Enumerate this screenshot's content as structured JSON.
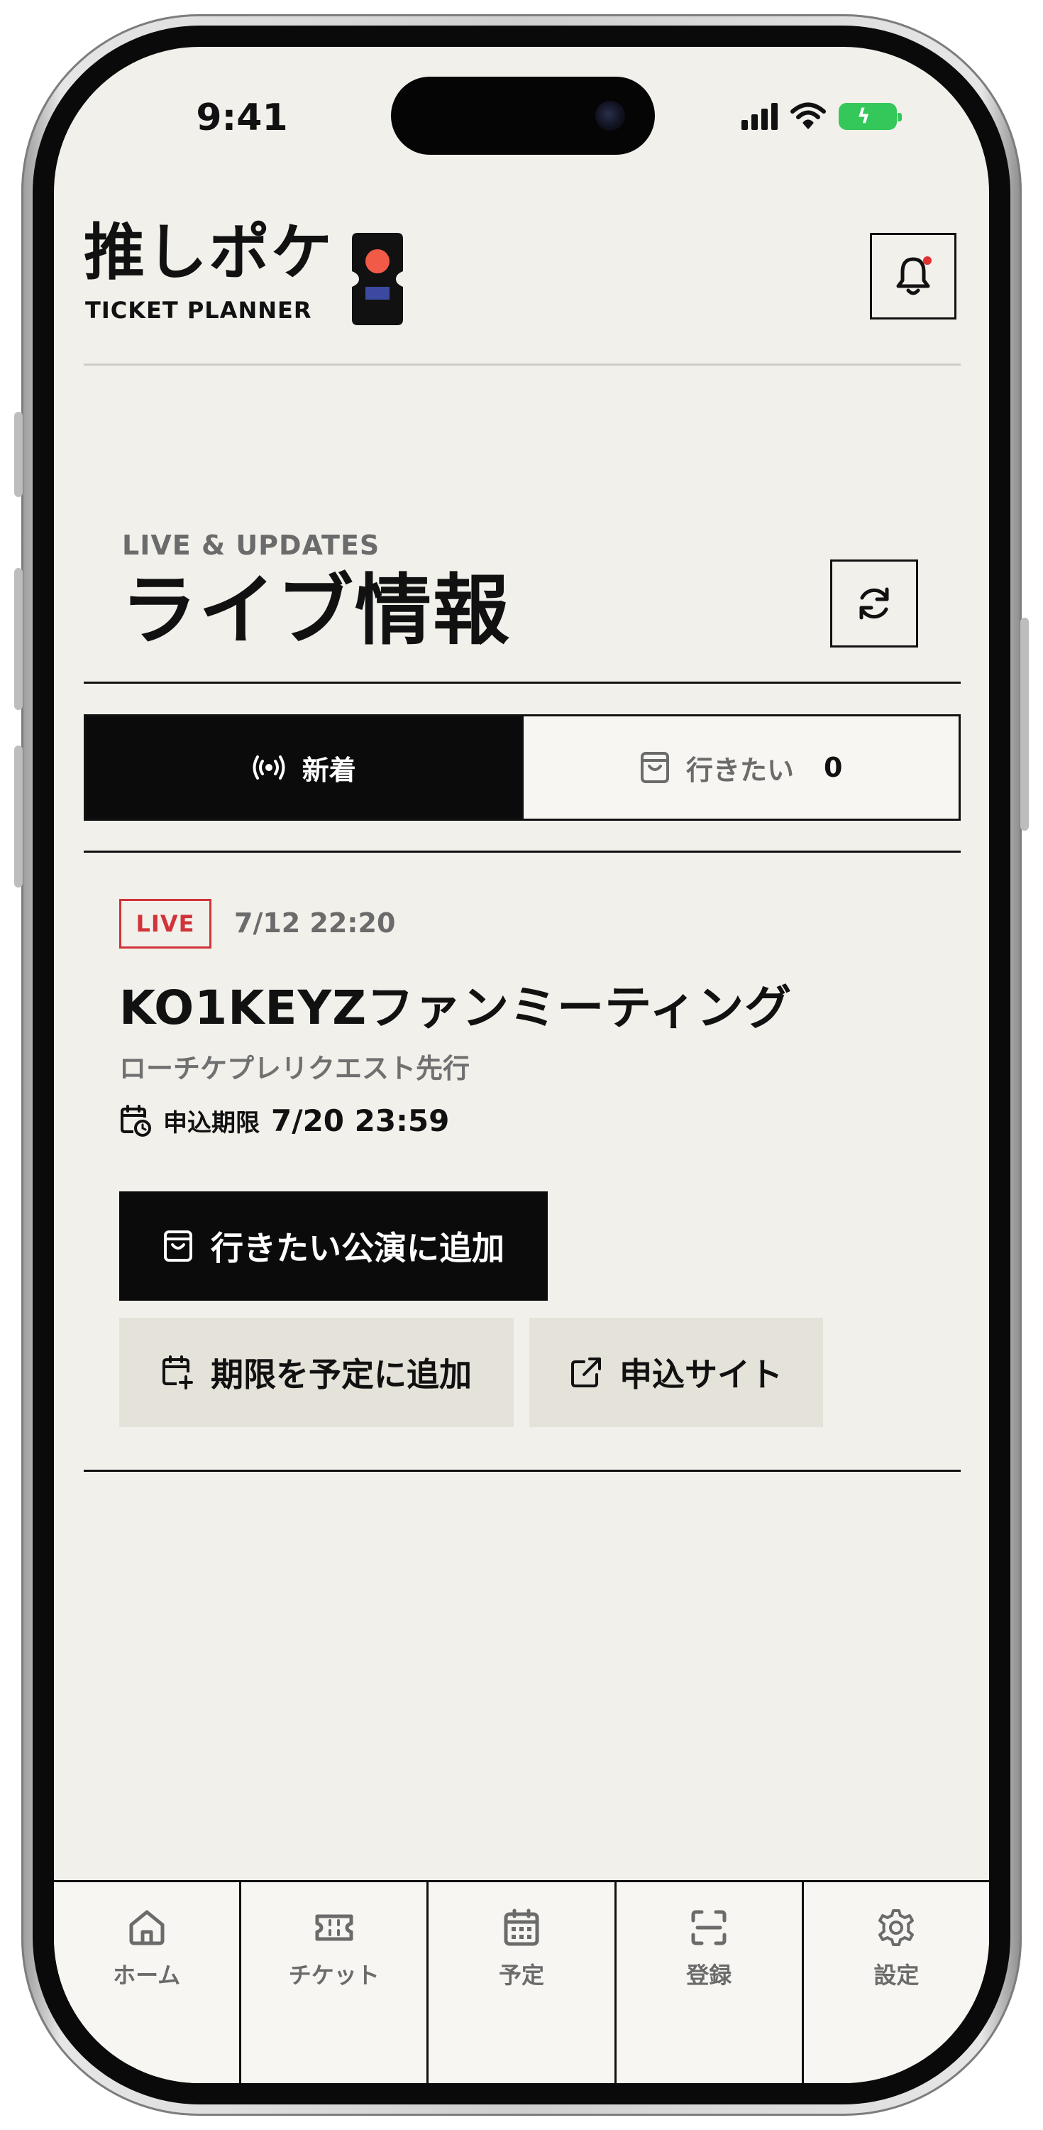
{
  "status_bar": {
    "time": "9:41"
  },
  "header": {
    "app_title": "推しポケ",
    "app_subtitle": "TICKET PLANNER",
    "logo_icon": "ticket-icon",
    "notification_icon": "bell-icon"
  },
  "section": {
    "kicker": "LIVE & UPDATES",
    "title": "ライブ情報",
    "refresh_icon": "refresh-icon"
  },
  "tabs": [
    {
      "label": "新着",
      "icon": "broadcast-icon",
      "active": true
    },
    {
      "label": "行きたい",
      "icon": "bag-icon",
      "count": "0",
      "active": false
    }
  ],
  "event": {
    "badge": "LIVE",
    "datetime": "7/12 22:20",
    "title": "KO1KEYZファンミーティング",
    "subtitle": "ローチケプレリクエスト先行",
    "deadline_label": "申込期限",
    "deadline_value": "7/20 23:59",
    "actions": {
      "want_label": "行きたい公演に追加",
      "schedule_label": "期限を予定に追加",
      "site_label": "申込サイト"
    }
  },
  "nav": [
    {
      "label": "ホーム",
      "icon": "home-icon"
    },
    {
      "label": "チケット",
      "icon": "ticket-icon"
    },
    {
      "label": "予定",
      "icon": "calendar-icon"
    },
    {
      "label": "登録",
      "icon": "scan-icon"
    },
    {
      "label": "設定",
      "icon": "gear-icon"
    }
  ],
  "colors": {
    "background": "#f2f0eb",
    "ink": "#111111",
    "accent_live": "#d0343a",
    "logo_red": "#f05a46",
    "logo_blue": "#3b4aa0",
    "secondary_button": "#e5e2da"
  }
}
